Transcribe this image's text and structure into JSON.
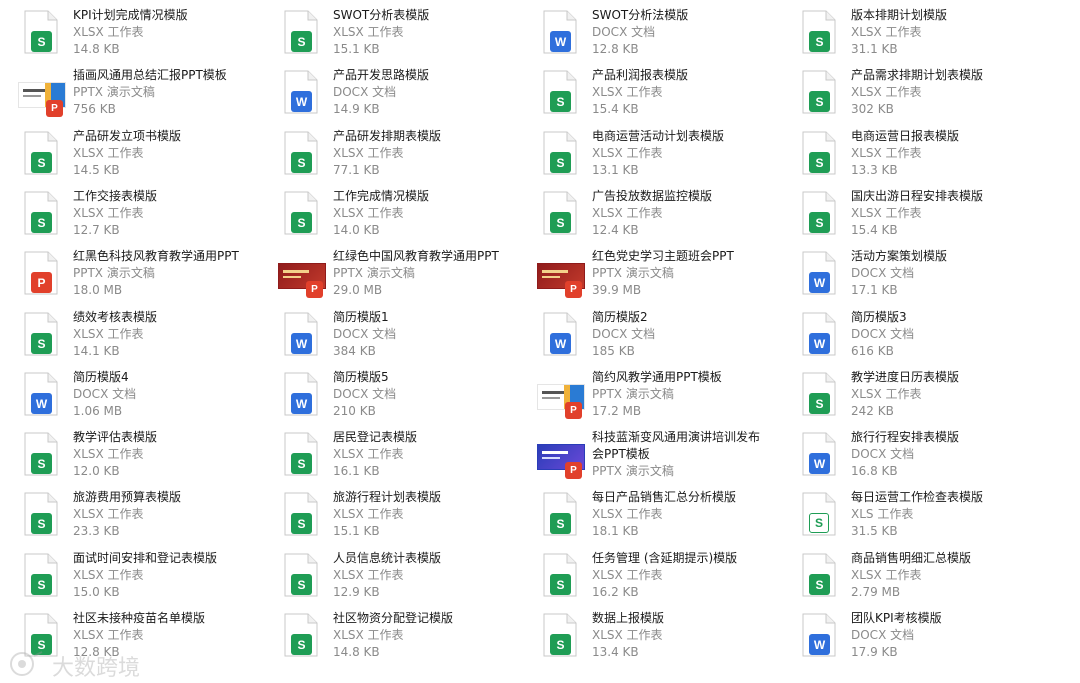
{
  "files": [
    {
      "name": "KPI计划完成情况模版",
      "type": "XLSX 工作表",
      "size": "14.8 KB",
      "icon": "xlsx"
    },
    {
      "name": "SWOT分析表模版",
      "type": "XLSX 工作表",
      "size": "15.1 KB",
      "icon": "xlsx"
    },
    {
      "name": "SWOT分析法模版",
      "type": "DOCX 文档",
      "size": "12.8 KB",
      "icon": "docx"
    },
    {
      "name": "版本排期计划模版",
      "type": "XLSX 工作表",
      "size": "31.1 KB",
      "icon": "xlsx"
    },
    {
      "name": "插画风通用总结汇报PPT模板",
      "type": "PPTX 演示文稿",
      "size": "756 KB",
      "icon": "pptx-thumb-light"
    },
    {
      "name": "产品开发思路模版",
      "type": "DOCX 文档",
      "size": "14.9 KB",
      "icon": "docx"
    },
    {
      "name": "产品利润报表模版",
      "type": "XLSX 工作表",
      "size": "15.4 KB",
      "icon": "xlsx"
    },
    {
      "name": "产品需求排期计划表模版",
      "type": "XLSX 工作表",
      "size": "302 KB",
      "icon": "xlsx"
    },
    {
      "name": "产品研发立项书模版",
      "type": "XLSX 工作表",
      "size": "14.5 KB",
      "icon": "xlsx"
    },
    {
      "name": "产品研发排期表模版",
      "type": "XLSX 工作表",
      "size": "77.1 KB",
      "icon": "xlsx"
    },
    {
      "name": "电商运营活动计划表模版",
      "type": "XLSX 工作表",
      "size": "13.1 KB",
      "icon": "xlsx"
    },
    {
      "name": "电商运营日报表模版",
      "type": "XLSX 工作表",
      "size": "13.3 KB",
      "icon": "xlsx"
    },
    {
      "name": "工作交接表模版",
      "type": "XLSX 工作表",
      "size": "12.7 KB",
      "icon": "xlsx"
    },
    {
      "name": "工作完成情况模版",
      "type": "XLSX 工作表",
      "size": "14.0 KB",
      "icon": "xlsx"
    },
    {
      "name": "广告投放数据监控模版",
      "type": "XLSX 工作表",
      "size": "12.4 KB",
      "icon": "xlsx"
    },
    {
      "name": "国庆出游日程安排表模版",
      "type": "XLSX 工作表",
      "size": "15.4 KB",
      "icon": "xlsx"
    },
    {
      "name": "红黑色科技风教育教学通用PPT",
      "type": "PPTX 演示文稿",
      "size": "18.0 MB",
      "icon": "pptx"
    },
    {
      "name": "红绿色中国风教育教学通用PPT",
      "type": "PPTX 演示文稿",
      "size": "29.0 MB",
      "icon": "pptx-thumb-red"
    },
    {
      "name": "红色党史学习主题班会PPT",
      "type": "PPTX 演示文稿",
      "size": "39.9 MB",
      "icon": "pptx-thumb-red"
    },
    {
      "name": "活动方案策划模版",
      "type": "DOCX 文档",
      "size": "17.1 KB",
      "icon": "docx"
    },
    {
      "name": "绩效考核表模版",
      "type": "XLSX 工作表",
      "size": "14.1 KB",
      "icon": "xlsx"
    },
    {
      "name": "简历模版1",
      "type": "DOCX 文档",
      "size": "384 KB",
      "icon": "docx"
    },
    {
      "name": "简历模版2",
      "type": "DOCX 文档",
      "size": "185 KB",
      "icon": "docx"
    },
    {
      "name": "简历模版3",
      "type": "DOCX 文档",
      "size": "616 KB",
      "icon": "docx"
    },
    {
      "name": "简历模版4",
      "type": "DOCX 文档",
      "size": "1.06 MB",
      "icon": "docx"
    },
    {
      "name": "简历模版5",
      "type": "DOCX 文档",
      "size": "210 KB",
      "icon": "docx"
    },
    {
      "name": "简约风教学通用PPT模板",
      "type": "PPTX 演示文稿",
      "size": "17.2 MB",
      "icon": "pptx-thumb-light"
    },
    {
      "name": "教学进度日历表模版",
      "type": "XLSX 工作表",
      "size": "242 KB",
      "icon": "xlsx"
    },
    {
      "name": "教学评估表模版",
      "type": "XLSX 工作表",
      "size": "12.0 KB",
      "icon": "xlsx"
    },
    {
      "name": "居民登记表模版",
      "type": "XLSX 工作表",
      "size": "16.1 KB",
      "icon": "xlsx"
    },
    {
      "name": "科技蓝渐变风通用演讲培训发布会PPT模板",
      "type": "PPTX 演示文稿",
      "size": "",
      "icon": "pptx-thumb-blue",
      "wrap": true
    },
    {
      "name": "旅行行程安排表模版",
      "type": "DOCX 文档",
      "size": "16.8 KB",
      "icon": "docx"
    },
    {
      "name": "旅游费用预算表模版",
      "type": "XLSX 工作表",
      "size": "23.3 KB",
      "icon": "xlsx"
    },
    {
      "name": "旅游行程计划表模版",
      "type": "XLSX 工作表",
      "size": "15.1 KB",
      "icon": "xlsx"
    },
    {
      "name": "每日产品销售汇总分析模版",
      "type": "XLSX 工作表",
      "size": "18.1 KB",
      "icon": "xlsx"
    },
    {
      "name": "每日运营工作检查表模版",
      "type": "XLS 工作表",
      "size": "31.5 KB",
      "icon": "xls"
    },
    {
      "name": "面试时间安排和登记表模版",
      "type": "XLSX 工作表",
      "size": "15.0 KB",
      "icon": "xlsx"
    },
    {
      "name": "人员信息统计表模版",
      "type": "XLSX 工作表",
      "size": "12.9 KB",
      "icon": "xlsx"
    },
    {
      "name": "任务管理 (含延期提示)模版",
      "type": "XLSX 工作表",
      "size": "16.2 KB",
      "icon": "xlsx"
    },
    {
      "name": "商品销售明细汇总模版",
      "type": "XLSX 工作表",
      "size": "2.79 MB",
      "icon": "xlsx"
    },
    {
      "name": "社区未接种疫苗名单模版",
      "type": "XLSX 工作表",
      "size": "12.8 KB",
      "icon": "xlsx"
    },
    {
      "name": "社区物资分配登记模版",
      "type": "XLSX 工作表",
      "size": "14.8 KB",
      "icon": "xlsx"
    },
    {
      "name": "数据上报模版",
      "type": "XLSX 工作表",
      "size": "13.4 KB",
      "icon": "xlsx"
    },
    {
      "name": "团队KPI考核模版",
      "type": "DOCX 文档",
      "size": "17.9 KB",
      "icon": "docx"
    }
  ],
  "watermark": {
    "text": "大数跨境"
  },
  "colors": {
    "xlsx": "#1f9d55",
    "docx": "#2f6fdc",
    "pptx": "#e1402b"
  }
}
